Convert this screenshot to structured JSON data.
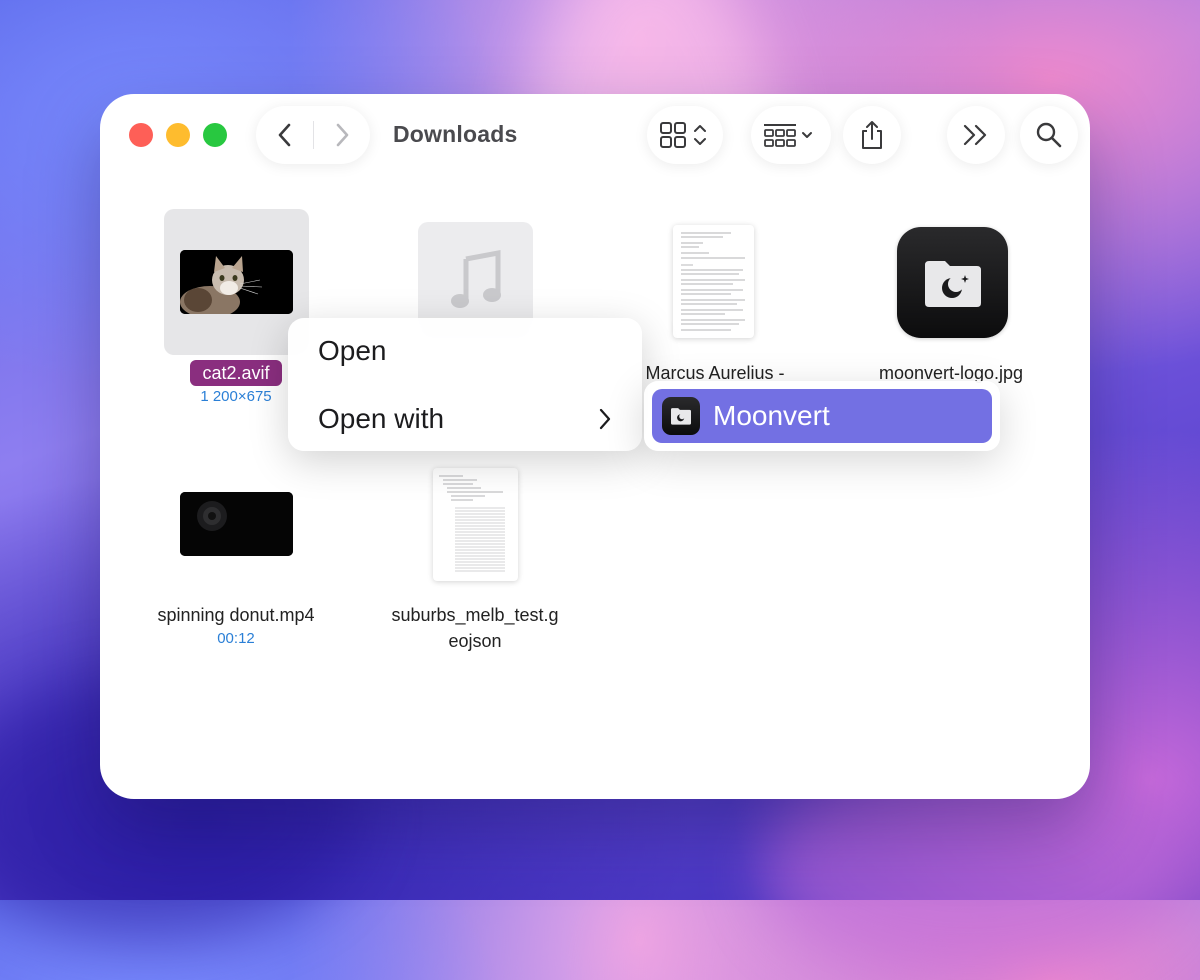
{
  "window": {
    "title": "Downloads"
  },
  "toolbar": {
    "back_icon": "chevron-left-icon",
    "forward_icon": "chevron-right-icon",
    "view_icon": "grid-icon",
    "group_icon": "group-grid-icon",
    "share_icon": "share-icon",
    "more_icon": "double-chevron-icon",
    "search_icon": "magnifier-icon"
  },
  "files": [
    {
      "name": "cat2.avif",
      "meta": "1 200×675",
      "selected": true
    },
    {
      "name": "",
      "meta": ""
    },
    {
      "name": "Marcus Aurelius -",
      "meta": ""
    },
    {
      "name": "moonvert-logo.jpg",
      "meta": ""
    },
    {
      "name": "spinning donut.mp4",
      "meta": "00:12"
    },
    {
      "name_line1": "suburbs_melb_test.g",
      "name_line2": "eojson",
      "meta": ""
    }
  ],
  "context_menu": {
    "open_label": "Open",
    "open_with_label": "Open with",
    "submenu": {
      "app_label": "Moonvert",
      "accent": "#7370e3"
    }
  },
  "colors": {
    "selection_highlight": "#8a2e7f",
    "meta_text": "#2a7fd6",
    "traffic_red": "#fe5f57",
    "traffic_yellow": "#febc2e",
    "traffic_green": "#28c840"
  }
}
